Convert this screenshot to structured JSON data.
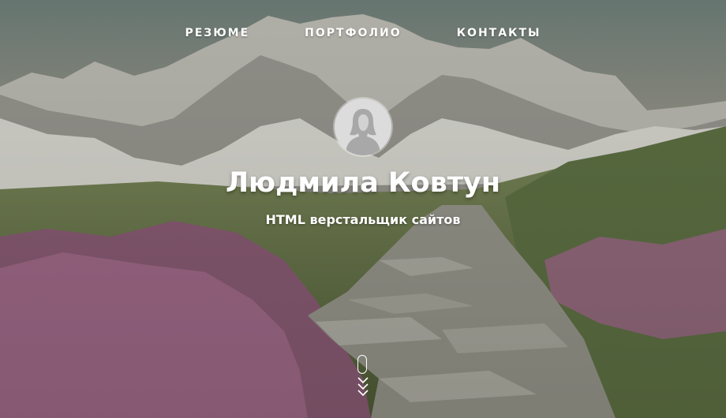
{
  "nav": {
    "items": [
      {
        "label": "РЕЗЮМЕ"
      },
      {
        "label": "ПОРТФОЛИО"
      },
      {
        "label": "КОНТАКТЫ"
      }
    ]
  },
  "hero": {
    "name": "Людмила Ковтун",
    "role": "HTML верстальщик сайтов"
  },
  "icons": {
    "avatar": "user-avatar-icon",
    "scroll": "scroll-down-icon"
  },
  "colors": {
    "text": "#ffffff",
    "avatar_bg": "#dcdcdc",
    "avatar_figure": "#a8a8a8"
  }
}
